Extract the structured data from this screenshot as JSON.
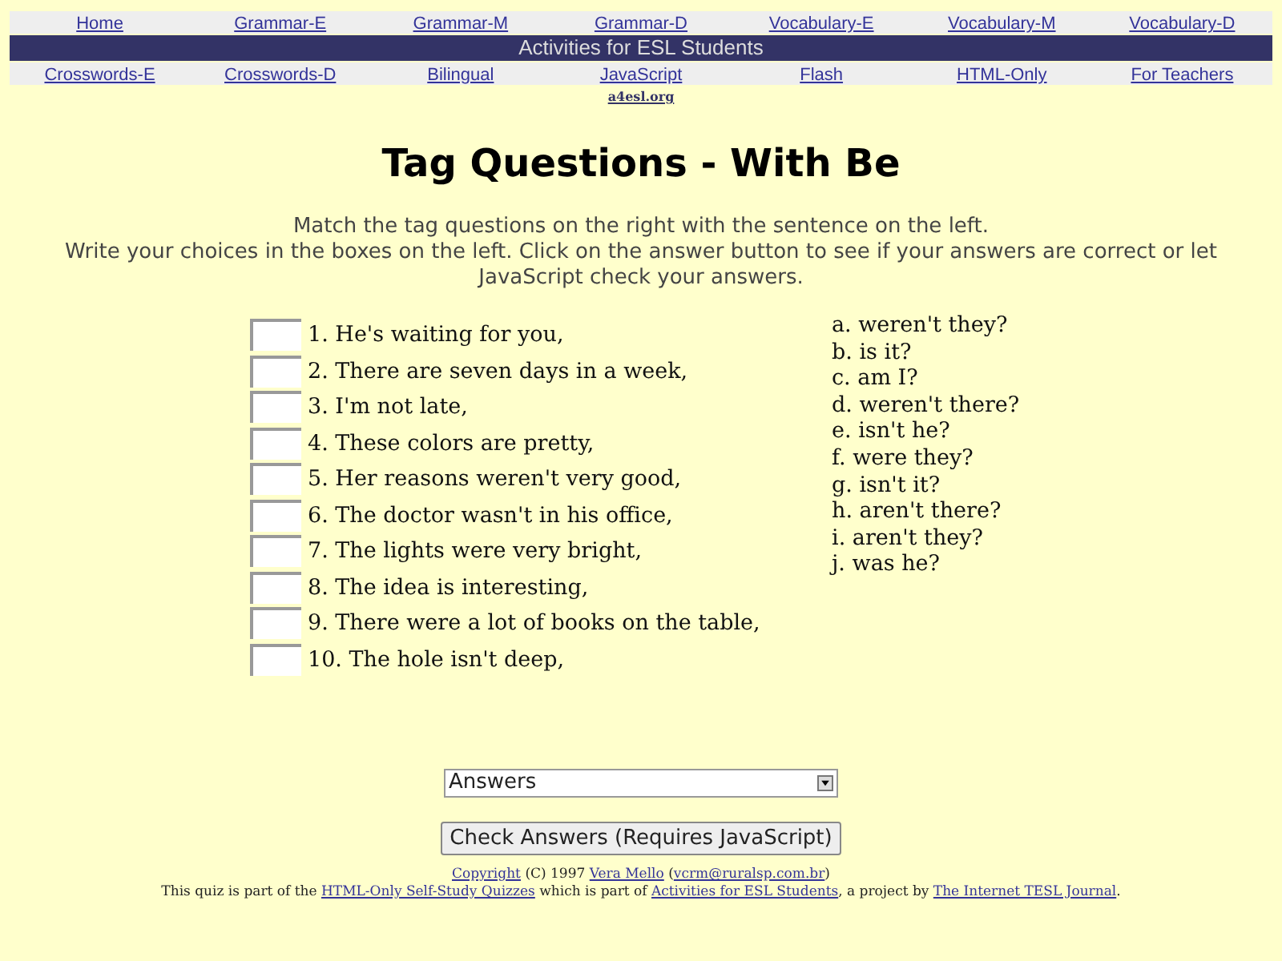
{
  "nav_top": [
    "Home",
    "Grammar-E",
    "Grammar-M",
    "Grammar-D",
    "Vocabulary-E",
    "Vocabulary-M",
    "Vocabulary-D"
  ],
  "banner": "Activities for ESL Students",
  "nav_bottom": [
    "Crosswords-E",
    "Crosswords-D",
    "Bilingual",
    "JavaScript",
    "Flash",
    "HTML-Only",
    "For Teachers"
  ],
  "site_link": "a4esl.org",
  "title": "Tag Questions - With Be",
  "instructions": [
    "Match the tag questions on the right with the sentence on the left.",
    "Write your choices in the boxes on the left. Click on the answer button to see if your answers are correct or let JavaScript check your answers."
  ],
  "questions": [
    "1. He's waiting for you,",
    "2. There are seven days in a week,",
    "3. I'm not late,",
    "4. These colors are pretty,",
    "5. Her reasons weren't very good,",
    "6. The doctor wasn't in his office,",
    "7. The lights were very bright,",
    "8. The idea is interesting,",
    "9. There were a lot of books on the table,",
    "10. The hole isn't deep,"
  ],
  "choices": [
    "a. weren't they?",
    "b. is it?",
    "c. am I?",
    "d. weren't there?",
    "e. isn't he?",
    "f. were they?",
    "g. isn't it?",
    "h. aren't there?",
    "i. aren't they?",
    "j. was he?"
  ],
  "answers_select": "Answers",
  "check_button": "Check Answers (Requires JavaScript)",
  "footer": {
    "line1": [
      {
        "kind": "link",
        "text": "Copyright"
      },
      {
        "kind": "text",
        "text": "(C) 1997"
      },
      {
        "kind": "link",
        "text": "Vera Mello"
      },
      {
        "kind": "text",
        "text": "("
      },
      {
        "kind": "link",
        "text": "vcrm@ruralsp.com.br"
      },
      {
        "kind": "text",
        "text": ")"
      }
    ],
    "line2": [
      {
        "kind": "text",
        "text": "This quiz is part of the"
      },
      {
        "kind": "link",
        "text": "HTML-Only Self-Study Quizzes"
      },
      {
        "kind": "text",
        "text": "which is part of"
      },
      {
        "kind": "link",
        "text": "Activities for ESL Students"
      },
      {
        "kind": "text",
        "text": ", a project by"
      },
      {
        "kind": "link",
        "text": "The Internet TESL Journal"
      },
      {
        "kind": "text",
        "text": "."
      }
    ]
  }
}
